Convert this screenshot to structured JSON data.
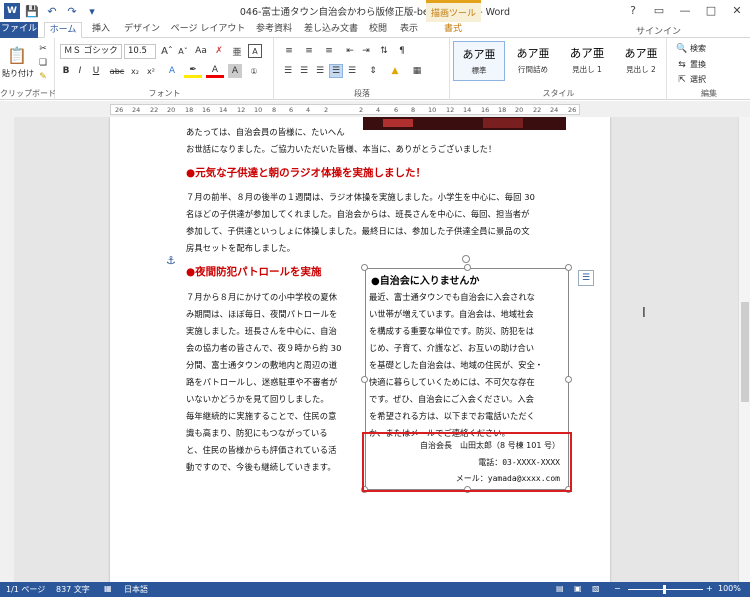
{
  "window": {
    "title": "046-富士通タウン自治会かわら版修正版-beforer.docx - Word",
    "context_tab_label": "描画ツール",
    "signin": "サインイン",
    "controls": [
      "?",
      "▭",
      "—",
      "□",
      "✕"
    ]
  },
  "tabs": [
    {
      "label": "ファイル"
    },
    {
      "label": "ホーム"
    },
    {
      "label": "挿入"
    },
    {
      "label": "デザイン"
    },
    {
      "label": "ページ レイアウト"
    },
    {
      "label": "参考資料"
    },
    {
      "label": "差し込み文書"
    },
    {
      "label": "校閲"
    },
    {
      "label": "表示"
    },
    {
      "label": "書式"
    }
  ],
  "ribbon": {
    "clipboard": {
      "label": "クリップボード",
      "paste": "貼り付け"
    },
    "font": {
      "label": "フォント",
      "font_name": "ＭＳ ゴシック (",
      "font_size": "10.5"
    },
    "paragraph": {
      "label": "段落"
    },
    "styles": {
      "label": "スタイル",
      "items": [
        {
          "sample": "あア亜",
          "name": "標準"
        },
        {
          "sample": "あア亜",
          "name": "行間詰め"
        },
        {
          "sample": "あア亜",
          "name": "見出し 1"
        },
        {
          "sample": "あア亜",
          "name": "見出し 2"
        }
      ]
    },
    "editing": {
      "label": "編集",
      "find": "検索",
      "replace": "置換",
      "select": "選択"
    }
  },
  "ruler": {
    "numbers": [
      "26",
      "24",
      "22",
      "20",
      "18",
      "16",
      "14",
      "12",
      "10",
      "8",
      "6",
      "4",
      "2",
      "",
      "2",
      "4",
      "6",
      "8",
      "10",
      "12",
      "14",
      "16",
      "18",
      "20",
      "22",
      "24",
      "26"
    ]
  },
  "document": {
    "intro_lines": [
      "あたっては、自治会員の皆様に、たいへん",
      "お世話になりました。ご協力いただいた皆様、本当に、ありがとうございました！"
    ],
    "section1": {
      "heading": "●元気な子供達と朝のラジオ体操を実施しました！",
      "lines": [
        "７月の前半、８月の後半の１週間は、ラジオ体操を実施しました。小学生を中心に、毎回 30",
        "名ほどの子供達が参加してくれました。自治会からは、班長さんを中心に、毎回、担当者が",
        "参加して、子供達といっしょに体操しました。最終日には、参加した子供達全員に景品の文",
        "房具セットを配布しました。"
      ]
    },
    "section2": {
      "heading": "●夜間防犯パトロールを実施",
      "lines": [
        "７月から８月にかけての小中学校の夏休",
        "み期間は、ほぼ毎日、夜間パトロールを",
        "実施しました。班長さんを中心に、自治",
        "会の協力者の皆さんで、夜９時から約 30",
        "分間、富士通タウンの敷地内と周辺の道",
        "路をパトロールし、迷惑駐車や不審者が",
        "いないかどうかを見て回りしました。",
        "毎年継続的に実施することで、住民の意",
        "識も高まり、防犯にもつながっている",
        "と、住民の皆様からも評価されている活",
        "動ですので、今後も継続していきます。"
      ]
    },
    "textbox": {
      "title": "●自治会に入りませんか",
      "lines": [
        "最近、富士通タウンでも自治会に入会されな",
        "い世帯が増えています。自治会は、地域社会",
        "を構成する重要な単位です。防災、防犯をは",
        "じめ、子育て、介護など、お互いの助け合い",
        "を基礎とした自治会は、地域の住民が、安全・",
        "快適に暮らしていくためには、不可欠な存在",
        "です。ぜひ、自治会にご入会ください。入会",
        "を希望される方は、以下までお電話いただく",
        "か、またはメールでご連絡ください。"
      ],
      "contact": [
        "自治会長　山田太郎（8 号棟 101 号）",
        "電話：03-XXXX-XXXX",
        "メール：yamada@xxxx.com"
      ]
    }
  },
  "status": {
    "page": "1/1 ページ",
    "words": "837 文字",
    "language": "日本語",
    "zoom": "100%"
  }
}
